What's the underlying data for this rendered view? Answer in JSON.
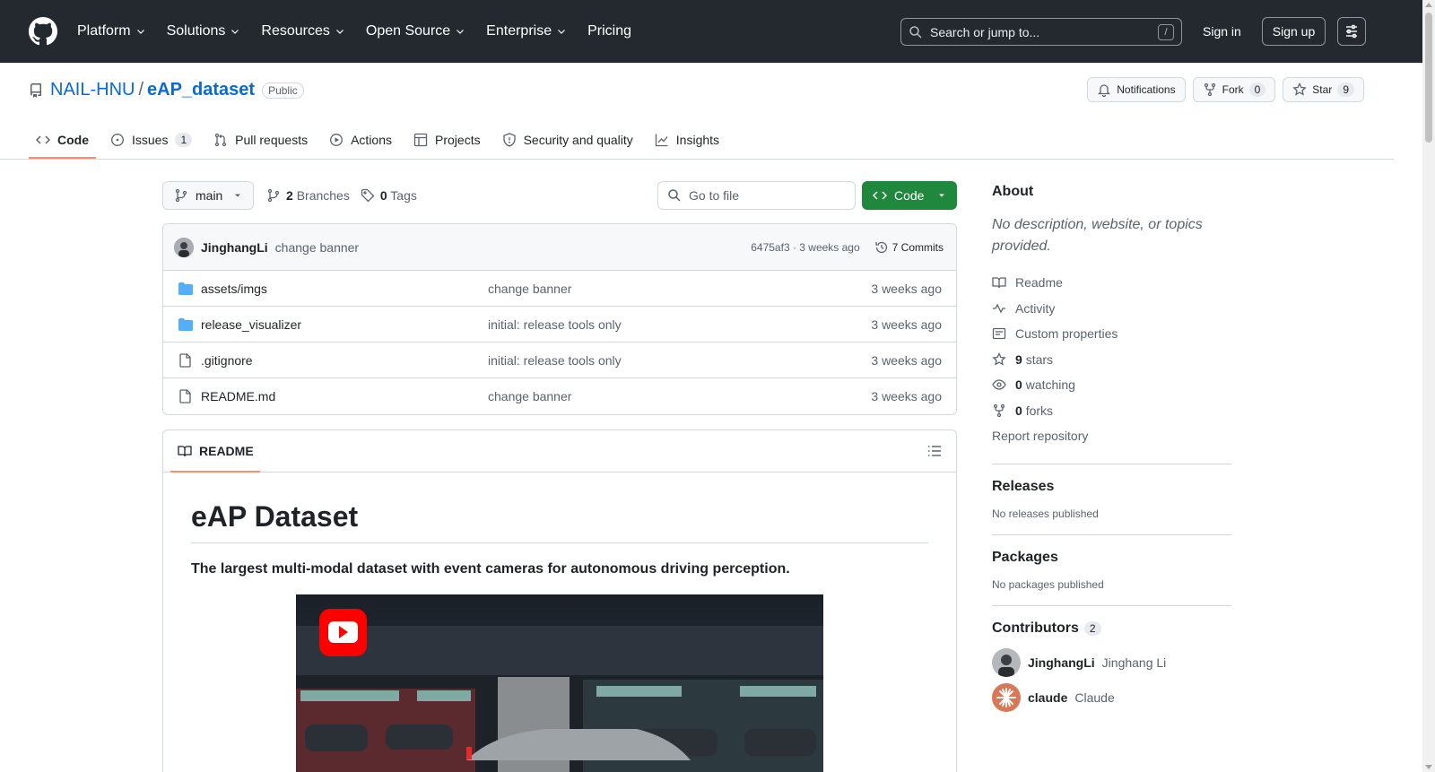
{
  "colors": {
    "header_bg": "#24292f",
    "link": "#0969da",
    "primary_button": "#1f883d",
    "tab_underline": "#fd8c73",
    "folder_icon": "#54aeff"
  },
  "header": {
    "nav": [
      {
        "label": "Platform",
        "has_menu": true
      },
      {
        "label": "Solutions",
        "has_menu": true
      },
      {
        "label": "Resources",
        "has_menu": true
      },
      {
        "label": "Open Source",
        "has_menu": true
      },
      {
        "label": "Enterprise",
        "has_menu": true
      },
      {
        "label": "Pricing",
        "has_menu": false
      }
    ],
    "search_placeholder": "Search or jump to...",
    "search_shortcut": "/",
    "sign_in": "Sign in",
    "sign_up": "Sign up"
  },
  "repo": {
    "owner": "NAIL-HNU",
    "separator": "/",
    "name": "eAP_dataset",
    "visibility": "Public",
    "notifications_label": "Notifications",
    "fork_label": "Fork",
    "fork_count": "0",
    "star_label": "Star",
    "star_count": "9"
  },
  "tabs": [
    {
      "label": "Code",
      "icon": "code-icon",
      "active": true
    },
    {
      "label": "Issues",
      "icon": "issue-icon",
      "count": "1"
    },
    {
      "label": "Pull requests",
      "icon": "pull-request-icon"
    },
    {
      "label": "Actions",
      "icon": "play-icon"
    },
    {
      "label": "Projects",
      "icon": "table-icon"
    },
    {
      "label": "Security and quality",
      "icon": "shield-icon"
    },
    {
      "label": "Insights",
      "icon": "graph-icon"
    }
  ],
  "toolbar": {
    "branch": "main",
    "branches_count": "2",
    "branches_label": "Branches",
    "tags_count": "0",
    "tags_label": "Tags",
    "go_to_file": "Go to file",
    "code_button": "Code"
  },
  "latest_commit": {
    "author": "JinghangLi",
    "message": "change banner",
    "hash_time": "6475af3 · 3 weeks ago",
    "commits_label": "7 Commits"
  },
  "files": [
    {
      "name": "assets/imgs",
      "type": "folder",
      "message": "change banner",
      "time": "3 weeks ago"
    },
    {
      "name": "release_visualizer",
      "type": "folder",
      "message": "initial: release tools only",
      "time": "3 weeks ago"
    },
    {
      "name": ".gitignore",
      "type": "file",
      "message": "initial: release tools only",
      "time": "3 weeks ago"
    },
    {
      "name": "README.md",
      "type": "file",
      "message": "change banner",
      "time": "3 weeks ago"
    }
  ],
  "readme": {
    "tab_label": "README",
    "title": "eAP Dataset",
    "lead": "The largest multi-modal dataset with event cameras for autonomous driving perception."
  },
  "sidebar": {
    "about_title": "About",
    "about_desc": "No description, website, or topics provided.",
    "links": [
      {
        "icon": "book-icon",
        "label": "Readme"
      },
      {
        "icon": "pulse-icon",
        "label": "Activity"
      },
      {
        "icon": "note-icon",
        "label": "Custom properties"
      },
      {
        "icon": "star-icon",
        "count": "9",
        "label": "stars"
      },
      {
        "icon": "eye-icon",
        "count": "0",
        "label": "watching"
      },
      {
        "icon": "fork-icon",
        "count": "0",
        "label": "forks"
      }
    ],
    "report": "Report repository",
    "releases_title": "Releases",
    "releases_empty": "No releases published",
    "packages_title": "Packages",
    "packages_empty": "No packages published",
    "contributors_title": "Contributors",
    "contributors_count": "2",
    "contributors": [
      {
        "login": "JinghangLi",
        "name": "Jinghang Li"
      },
      {
        "login": "claude",
        "name": "Claude"
      }
    ]
  }
}
